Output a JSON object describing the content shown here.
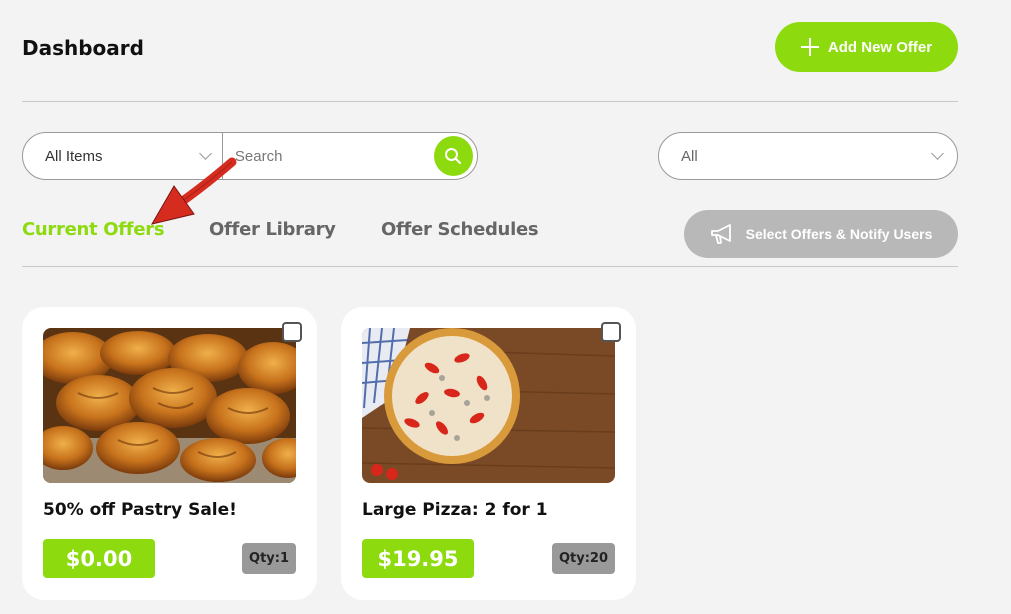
{
  "header": {
    "title": "Dashboard",
    "add_button_label": "Add New Offer"
  },
  "filters": {
    "items_select_value": "All Items",
    "search_placeholder": "Search",
    "status_select_value": "All"
  },
  "tabs": [
    {
      "label": "Current Offers",
      "active": true
    },
    {
      "label": "Offer Library",
      "active": false
    },
    {
      "label": "Offer Schedules",
      "active": false
    }
  ],
  "notify_button_label": "Select Offers & Notify Users",
  "offers": [
    {
      "title": "50% off Pastry Sale!",
      "price": "$0.00",
      "qty": "Qty:1",
      "image": "croissants-photo"
    },
    {
      "title": "Large Pizza: 2 for 1",
      "price": "$19.95",
      "qty": "Qty:20",
      "image": "pizza-photo"
    }
  ],
  "colors": {
    "accent": "#8ddb0f",
    "disabled": "#b8b8b8",
    "annotation_arrow": "#d62b1f"
  }
}
